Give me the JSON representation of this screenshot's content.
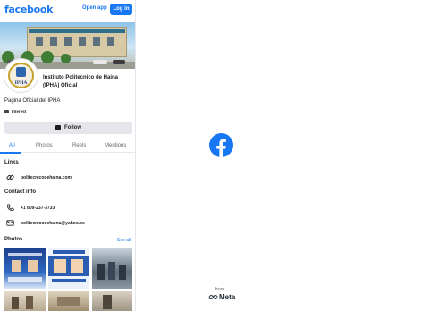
{
  "header": {
    "brand": "facebook",
    "open_app": "Open app",
    "login": "Log in"
  },
  "profile": {
    "avatar_text": "IPHA",
    "name": "Instituto Politecnico de Haina (IPHA) Oficial",
    "description": "Pagina Oficial del IPHA",
    "category": "Interest",
    "follow_label": "Follow"
  },
  "tabs": [
    "All",
    "Photos",
    "Reels",
    "Mentions"
  ],
  "links": {
    "title": "Links",
    "items": [
      {
        "icon": "link-icon",
        "text": "politecnicodehaina.com"
      }
    ]
  },
  "contact": {
    "title": "Contact info",
    "phone": "+1 809-237-3733",
    "email": "politecnicodehaina@yahoo.es"
  },
  "photos": {
    "title": "Photos",
    "see_all": "See all"
  },
  "footer": {
    "from": "from",
    "meta": "Meta"
  },
  "colors": {
    "brand_blue": "#1877f2",
    "button_gray": "#e4e6eb",
    "text": "#1c1e21",
    "muted": "#65676b"
  }
}
